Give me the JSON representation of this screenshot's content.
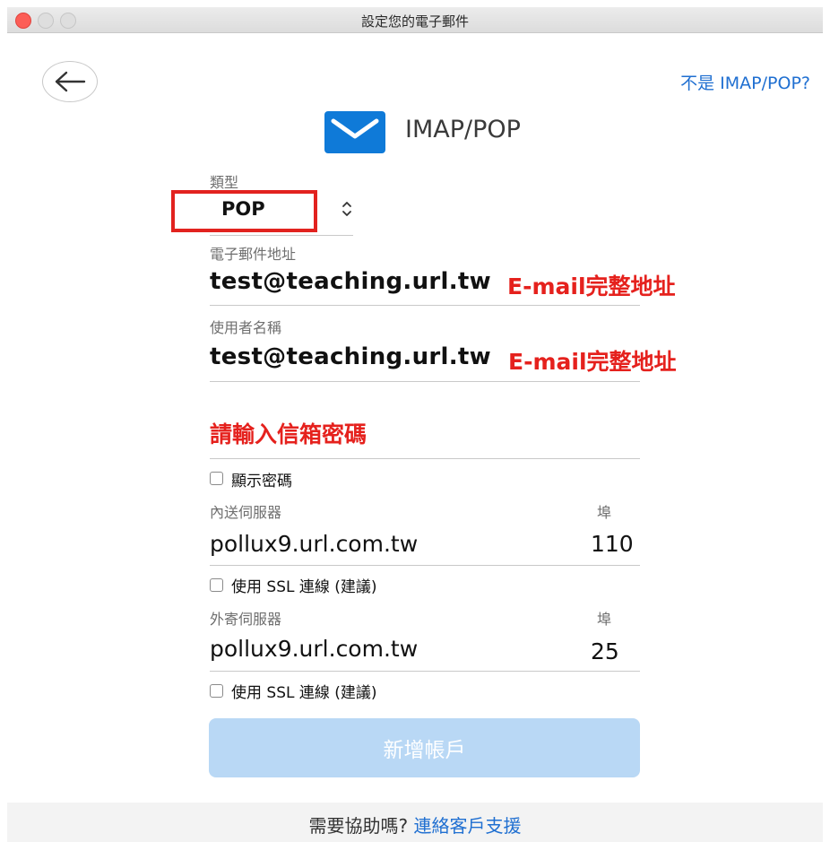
{
  "window": {
    "title": "設定您的電子郵件"
  },
  "header": {
    "not_imap_link": "不是 IMAP/POP?",
    "title": "IMAP/POP",
    "icon": "mail-envelope-icon"
  },
  "type": {
    "label": "類型",
    "value": "POP"
  },
  "email": {
    "label": "電子郵件地址",
    "value": "test@teaching.url.tw",
    "annotation": "E-mail完整地址"
  },
  "username": {
    "label": "使用者名稱",
    "value": "test@teaching.url.tw",
    "annotation": "E-mail完整地址"
  },
  "password": {
    "annotation": "請輸入信箱密碼"
  },
  "show_password": {
    "label": "顯示密碼",
    "checked": false
  },
  "incoming": {
    "label": "內送伺服器",
    "port_label": "埠",
    "value": "pollux9.url.com.tw",
    "port": "110",
    "ssl_label": "使用 SSL 連線 (建議)",
    "ssl_checked": false
  },
  "outgoing": {
    "label": "外寄伺服器",
    "port_label": "埠",
    "value": "pollux9.url.com.tw",
    "port": "25",
    "ssl_label": "使用 SSL 連線 (建議)",
    "ssl_checked": false
  },
  "add_account_button": "新增帳戶",
  "footer": {
    "help_text": "需要協助嗎?",
    "help_link": "連絡客戶支援"
  },
  "colors": {
    "accent": "#1f6fd1",
    "annotation_red": "#e5211d",
    "button_disabled": "#b9d8f5",
    "mail_icon": "#0f7ad8"
  }
}
